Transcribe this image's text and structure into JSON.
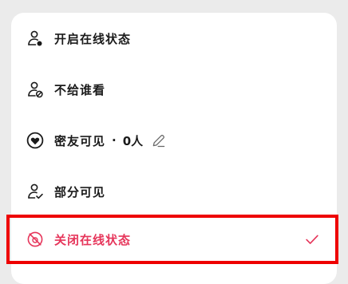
{
  "visibility_menu": {
    "items": [
      {
        "label": "开启在线状态",
        "icon": "user-online-icon"
      },
      {
        "label": "不给谁看",
        "icon": "user-blocked-icon"
      },
      {
        "label": "密友可见",
        "icon": "heart-circle-icon",
        "separator": "·",
        "count": "0人",
        "edit_icon": "pencil-icon"
      },
      {
        "label": "部分可见",
        "icon": "user-check-icon"
      },
      {
        "label": "关闭在线状态",
        "icon": "offline-icon",
        "selected": true,
        "check_icon": "checkmark-icon"
      }
    ]
  },
  "colors": {
    "text": "#1a1a1a",
    "selected": "#e6355a",
    "highlight_border": "#ee0000",
    "card_background": "#ffffff",
    "page_background": "#ebebeb"
  }
}
